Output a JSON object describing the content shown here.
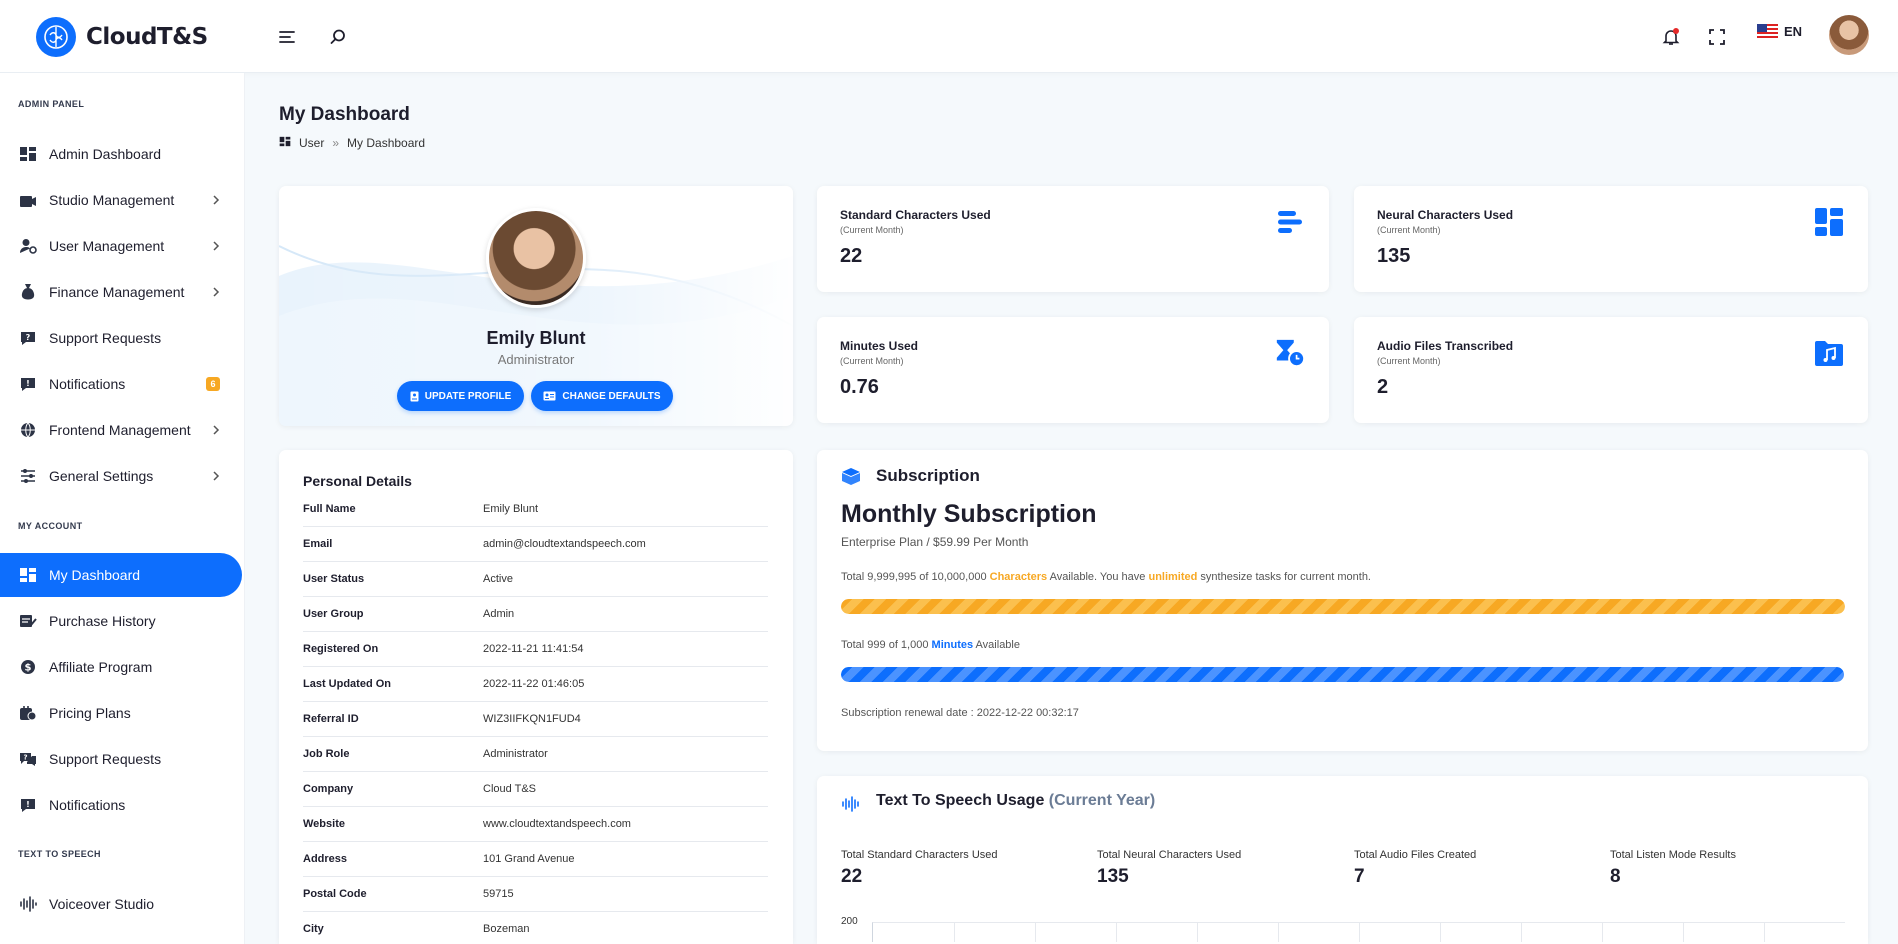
{
  "brand": {
    "name": "CloudT&S"
  },
  "header": {
    "language": "EN"
  },
  "sidebar": {
    "sections": [
      {
        "heading": "ADMIN PANEL"
      },
      {
        "heading": "MY ACCOUNT"
      },
      {
        "heading": "TEXT TO SPEECH"
      }
    ],
    "items": [
      {
        "label": "Admin Dashboard",
        "icon": "dashboard-icon"
      },
      {
        "label": "Studio Management",
        "icon": "studio-icon"
      },
      {
        "label": "User Management",
        "icon": "user-cog-icon"
      },
      {
        "label": "Finance Management",
        "icon": "money-bag-icon"
      },
      {
        "label": "Support Requests",
        "icon": "question-bubble-icon"
      },
      {
        "label": "Notifications",
        "icon": "alert-bubble-icon",
        "badge": "6"
      },
      {
        "label": "Frontend Management",
        "icon": "globe-icon"
      },
      {
        "label": "General Settings",
        "icon": "sliders-icon"
      },
      {
        "label": "My Dashboard",
        "icon": "dashboard-icon"
      },
      {
        "label": "Purchase History",
        "icon": "purchase-icon"
      },
      {
        "label": "Affiliate Program",
        "icon": "dollar-circle-icon"
      },
      {
        "label": "Pricing Plans",
        "icon": "pricing-icon"
      },
      {
        "label": "Support Requests",
        "icon": "question-bubble-icon"
      },
      {
        "label": "Notifications",
        "icon": "alert-bubble-icon"
      },
      {
        "label": "Voiceover Studio",
        "icon": "waveform-icon"
      }
    ]
  },
  "page": {
    "title": "My Dashboard",
    "breadcrumb": [
      "User",
      "My Dashboard"
    ]
  },
  "profile": {
    "name": "Emily Blunt",
    "role": "Administrator",
    "update_label": "UPDATE PROFILE",
    "defaults_label": "CHANGE DEFAULTS"
  },
  "stats": [
    {
      "label": "Standard Characters Used",
      "sub": "(Current Month)",
      "value": "22"
    },
    {
      "label": "Neural Characters Used",
      "sub": "(Current Month)",
      "value": "135"
    },
    {
      "label": "Minutes Used",
      "sub": "(Current Month)",
      "value": "0.76"
    },
    {
      "label": "Audio Files Transcribed",
      "sub": "(Current Month)",
      "value": "2"
    }
  ],
  "personal": {
    "title": "Personal Details",
    "rows": [
      {
        "label": "Full Name",
        "value": "Emily Blunt"
      },
      {
        "label": "Email",
        "value": "admin@cloudtextandspeech.com"
      },
      {
        "label": "User Status",
        "value": "Active"
      },
      {
        "label": "User Group",
        "value": "Admin"
      },
      {
        "label": "Registered On",
        "value": "2022-11-21 11:41:54"
      },
      {
        "label": "Last Updated On",
        "value": "2022-11-22 01:46:05"
      },
      {
        "label": "Referral ID",
        "value": "WIZ3IIFKQN1FUD4"
      },
      {
        "label": "Job Role",
        "value": "Administrator"
      },
      {
        "label": "Company",
        "value": "Cloud T&S"
      },
      {
        "label": "Website",
        "value": "www.cloudtextandspeech.com"
      },
      {
        "label": "Address",
        "value": "101 Grand Avenue"
      },
      {
        "label": "Postal Code",
        "value": "59715"
      },
      {
        "label": "City",
        "value": "Bozeman"
      }
    ]
  },
  "subscription": {
    "title": "Subscription",
    "plan": "Monthly Subscription",
    "price": "Enterprise Plan / $59.99 Per Month",
    "chars_pre": "Total 9,999,995 of 10,000,000",
    "chars_word": "Characters",
    "chars_mid": "Available. You have",
    "chars_unlimited": "unlimited",
    "chars_post": "synthesize tasks for current month.",
    "chars_fraction": 0.9999995,
    "minutes_pre": "Total 999 of 1,000",
    "minutes_word": "Minutes",
    "minutes_post": "Available",
    "minutes_fraction": 0.999,
    "renewal": "Subscription renewal date : 2022-12-22 00:32:17",
    "orange": "#f7a823",
    "blue": "#0d6efd"
  },
  "tts": {
    "title": "Text To Speech Usage",
    "title_muted": "(Current Year)",
    "stats": [
      {
        "label": "Total Standard Characters Used",
        "value": "22"
      },
      {
        "label": "Total Neural Characters Used",
        "value": "135"
      },
      {
        "label": "Total Audio Files Created",
        "value": "7"
      },
      {
        "label": "Total Listen Mode Results",
        "value": "8"
      }
    ],
    "y_max_label": "200"
  }
}
